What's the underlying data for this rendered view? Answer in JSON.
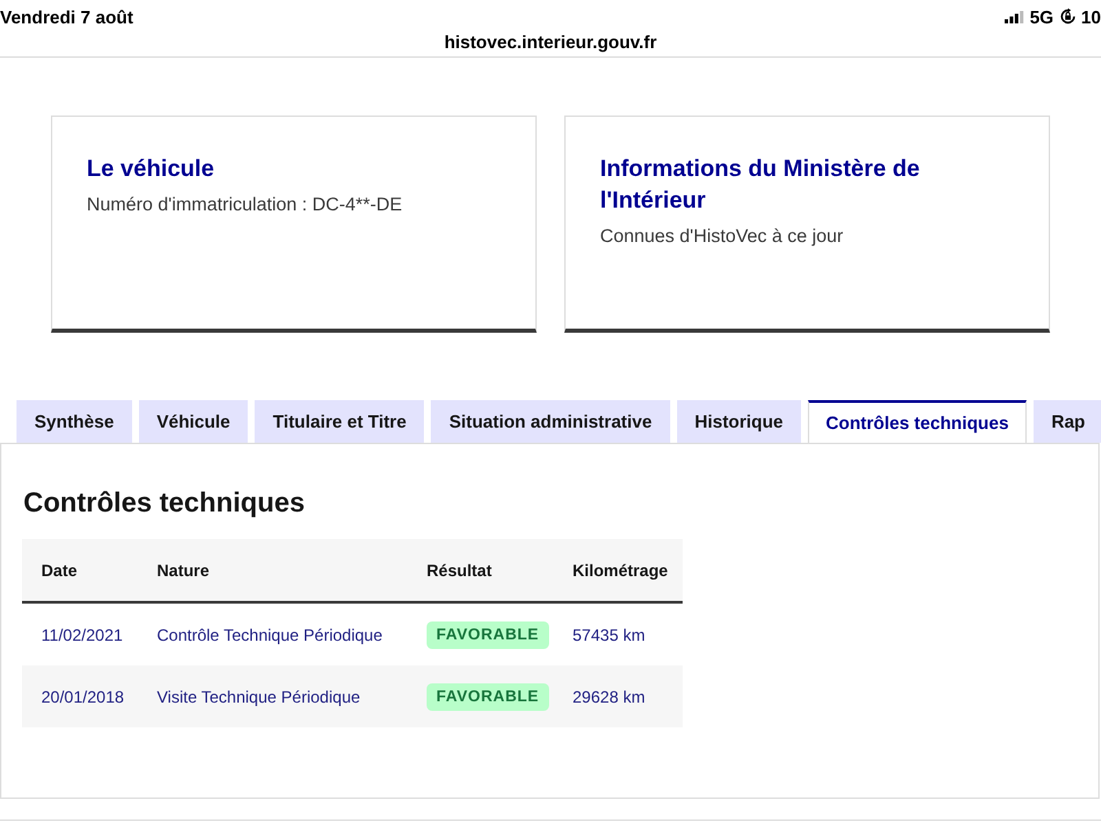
{
  "status_bar": {
    "date": "Vendredi 7 août",
    "network": "5G",
    "battery": "10"
  },
  "address_bar": {
    "url": "histovec.interieur.gouv.fr"
  },
  "cards": [
    {
      "title": "Le véhicule",
      "text": "Numéro d'immatriculation : DC-4**-DE"
    },
    {
      "title": "Informations du Ministère de l'Intérieur",
      "text": "Connues d'HistoVec à ce jour"
    }
  ],
  "tabs": [
    {
      "label": "Synthèse",
      "selected": false
    },
    {
      "label": "Véhicule",
      "selected": false
    },
    {
      "label": "Titulaire et Titre",
      "selected": false
    },
    {
      "label": "Situation administrative",
      "selected": false
    },
    {
      "label": "Historique",
      "selected": false
    },
    {
      "label": "Contrôles techniques",
      "selected": true
    },
    {
      "label": "Rap",
      "selected": false
    }
  ],
  "panel": {
    "title": "Contrôles techniques",
    "table": {
      "columns": [
        "Date",
        "Nature",
        "Résultat",
        "Kilométrage"
      ],
      "rows": [
        {
          "date": "11/02/2021",
          "nature": "Contrôle Technique Périodique",
          "result": "FAVORABLE",
          "mileage": "57435 km"
        },
        {
          "date": "20/01/2018",
          "nature": "Visite Technique Périodique",
          "result": "FAVORABLE",
          "mileage": "29628 km"
        }
      ]
    }
  }
}
